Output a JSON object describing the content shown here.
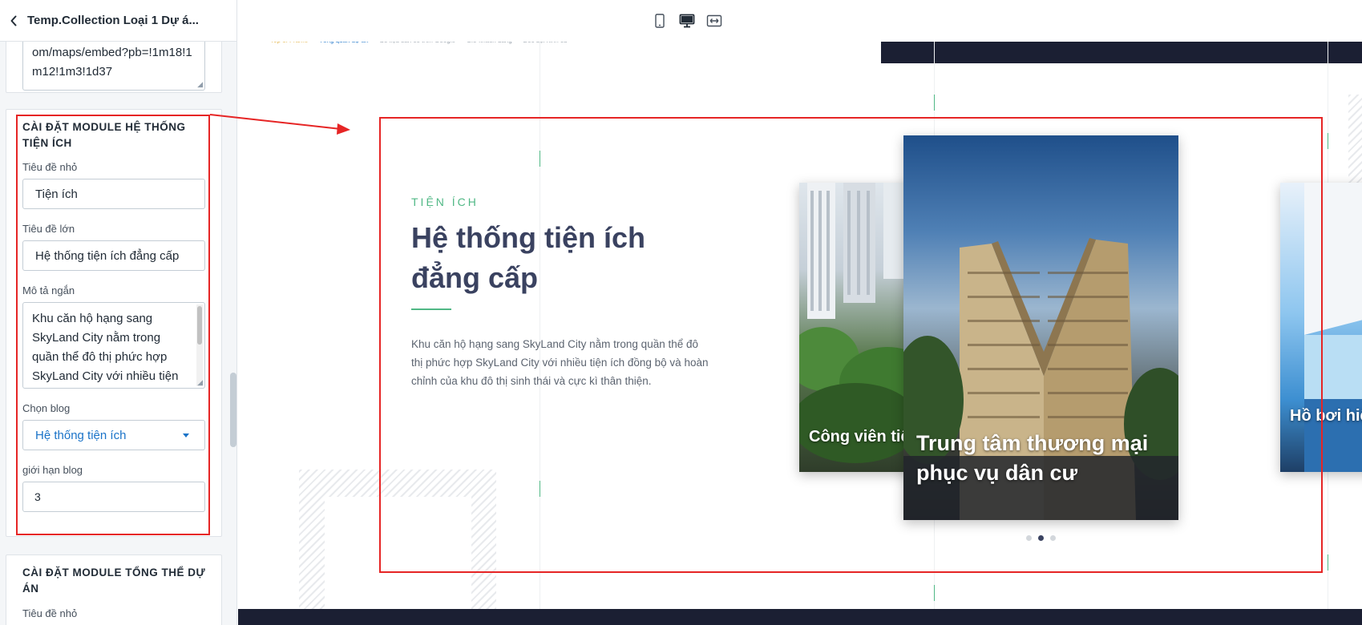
{
  "header": {
    "title": "Temp.Collection Loại 1 Dự á..."
  },
  "prev_card": {
    "textarea_text": "om/maps/embed?pb=!1m18!1m12!1m3!1d37"
  },
  "amenities_module": {
    "title": "CÀI ĐẶT MODULE HỆ THỐNG TIỆN ÍCH",
    "small_title_label": "Tiêu đề nhỏ",
    "small_title_value": "Tiện ích",
    "big_title_label": "Tiêu đề lớn",
    "big_title_value": "Hệ thống tiện ích đẳng cấp",
    "short_desc_label": "Mô tả ngắn",
    "short_desc_value": "Khu căn hộ hạng sang SkyLand City nằm trong quần thể đô thị phức hợp SkyLand City với nhiều tiện ích đồng bộ và hoàn chỉnh của khu đô thị sinh thái và cực kì thân thiện.",
    "blog_label": "Chọn blog",
    "blog_value": "Hệ thống tiện ích",
    "limit_label": "giới hạn blog",
    "limit_value": "3"
  },
  "overview_module": {
    "title": "CÀI ĐẶT MODULE TỔNG THỂ DỰ ÁN",
    "small_title_label": "Tiêu đề nhỏ"
  },
  "preview": {
    "kicker": "TIỆN ÍCH",
    "heading": "Hệ thống tiện ích đẳng cấp",
    "description": "Khu căn hộ hạng sang SkyLand City nằm trong quần thể đô thị phức hợp SkyLand City với nhiều tiện ích đồng bộ và hoàn chỉnh của khu đô thị sinh thái và cực kì thân thiện.",
    "slides": [
      {
        "caption": "Công viên tiện ích"
      },
      {
        "caption": "Trung tâm thương mại phục vụ dân cư"
      },
      {
        "caption": "Hồ bơi hiện đại cao cấp"
      }
    ],
    "strip_labels": [
      "Top of Frame",
      "Tổng quan dự án",
      "Số liệu sản có trên Google",
      "Giờ khách đang",
      "Bốc đội hinh cũ"
    ]
  },
  "colors": {
    "accent_green": "#50b885",
    "heading_navy": "#3a4260",
    "annotation_red": "#e62525",
    "link_blue": "#1a73c8"
  },
  "icons": {
    "back": "chevron-left-icon",
    "mobile": "mobile-device-icon",
    "desktop": "desktop-monitor-icon",
    "fullwidth": "expand-width-icon"
  }
}
